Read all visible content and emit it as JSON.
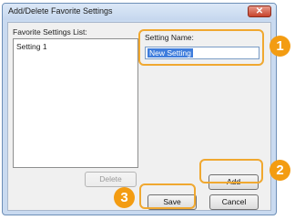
{
  "window": {
    "title": "Add/Delete Favorite Settings",
    "close_glyph": "✕"
  },
  "favorites": {
    "list_label": "Favorite Settings List:",
    "items": [
      "Setting 1"
    ]
  },
  "setting_name": {
    "label": "Setting Name:",
    "value": "New Setting"
  },
  "buttons": {
    "delete": "Delete",
    "add": "Add",
    "save": "Save",
    "cancel": "Cancel"
  },
  "callouts": [
    "1",
    "2",
    "3"
  ],
  "colors": {
    "callout": "#f39c12",
    "selection": "#3f7ddc",
    "title_bar": "#c9daf0"
  }
}
